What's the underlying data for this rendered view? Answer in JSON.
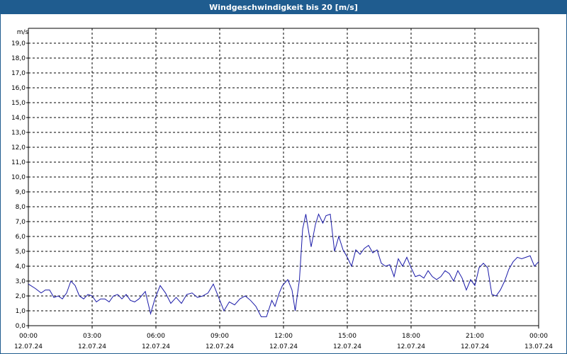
{
  "chart_data": {
    "type": "line",
    "title": "Windgeschwindigkeit bis 20 [m/s]",
    "ylabel": "m/s",
    "xlabel": "",
    "ylim": [
      0,
      20
    ],
    "xlim_hours": [
      0,
      24
    ],
    "grid": true,
    "y_ticks": [
      "0,0",
      "1,0",
      "2,0",
      "3,0",
      "4,0",
      "5,0",
      "6,0",
      "7,0",
      "8,0",
      "9,0",
      "10,0",
      "11,0",
      "12,0",
      "13,0",
      "14,0",
      "15,0",
      "16,0",
      "17,0",
      "18,0",
      "19,0"
    ],
    "x_ticks": [
      {
        "time": "00:00",
        "date": "12.07.24"
      },
      {
        "time": "03:00",
        "date": "12.07.24"
      },
      {
        "time": "06:00",
        "date": "12.07.24"
      },
      {
        "time": "09:00",
        "date": "12.07.24"
      },
      {
        "time": "12:00",
        "date": "12.07.24"
      },
      {
        "time": "15:00",
        "date": "12.07.24"
      },
      {
        "time": "18:00",
        "date": "12.07.24"
      },
      {
        "time": "21:00",
        "date": "12.07.24"
      },
      {
        "time": "00:00",
        "date": "13.07.24"
      }
    ],
    "series_color": "#1a1aa8",
    "series": [
      {
        "hours": [
          0,
          0.33,
          0.6,
          0.8,
          1.0,
          1.2,
          1.4,
          1.6,
          1.8,
          2.0,
          2.2,
          2.4,
          2.6,
          2.8,
          3.0,
          3.2,
          3.4,
          3.6,
          3.8,
          4.0,
          4.2,
          4.4,
          4.6,
          4.8,
          5.0,
          5.2,
          5.5,
          5.75,
          5.95,
          6.2,
          6.45,
          6.7,
          6.95,
          7.2,
          7.45,
          7.7,
          7.95,
          8.2,
          8.45,
          8.7,
          8.95,
          9.2,
          9.45,
          9.7,
          9.95,
          10.2,
          10.45,
          10.7,
          10.95,
          11.2,
          11.45,
          11.6,
          11.8,
          11.95,
          12.2,
          12.4,
          12.55,
          12.75,
          12.9,
          13.05,
          13.3,
          13.5,
          13.65,
          13.85,
          14.0,
          14.2,
          14.4,
          14.6,
          14.8,
          15.0,
          15.2,
          15.4,
          15.6,
          15.8,
          16.0,
          16.2,
          16.4,
          16.6,
          16.8,
          17.0,
          17.2,
          17.4,
          17.6,
          17.8,
          18.0,
          18.2,
          18.4,
          18.6,
          18.8,
          19.0,
          19.2,
          19.4,
          19.6,
          19.8,
          20.0,
          20.2,
          20.4,
          20.6,
          20.8,
          21.0,
          21.2,
          21.4,
          21.6,
          21.8,
          22.0,
          22.2,
          22.4,
          22.6,
          22.8,
          23.0,
          23.2,
          23.4,
          23.6,
          23.8,
          24.0
        ],
        "values": [
          2.8,
          2.5,
          2.2,
          2.4,
          2.4,
          1.9,
          2.0,
          1.8,
          2.2,
          3.0,
          2.7,
          2.0,
          1.8,
          2.1,
          2.0,
          1.6,
          1.8,
          1.8,
          1.6,
          2.0,
          2.1,
          1.8,
          2.1,
          1.7,
          1.6,
          1.8,
          2.3,
          0.8,
          1.8,
          2.7,
          2.2,
          1.5,
          1.9,
          1.5,
          2.1,
          2.2,
          1.9,
          2.0,
          2.2,
          2.8,
          1.9,
          1.0,
          1.6,
          1.4,
          1.8,
          2.0,
          1.7,
          1.3,
          0.6,
          0.6,
          1.7,
          1.3,
          2.2,
          2.7,
          3.1,
          2.4,
          1.0,
          3.1,
          6.5,
          7.5,
          5.3,
          6.8,
          7.5,
          6.9,
          7.4,
          7.5,
          5.0,
          6.0,
          5.1,
          4.6,
          4.0,
          5.1,
          4.8,
          5.2,
          5.4,
          4.9,
          5.1,
          4.2,
          4.0,
          4.1,
          3.3,
          4.5,
          4.0,
          4.6,
          3.9,
          3.3,
          3.4,
          3.2,
          3.7,
          3.3,
          3.1,
          3.3,
          3.7,
          3.5,
          3.0,
          3.7,
          3.2,
          2.4,
          3.1,
          2.7,
          3.9,
          4.2,
          3.9,
          2.1,
          2.0,
          2.4,
          3.0,
          3.8,
          4.3,
          4.6,
          4.5,
          4.6,
          4.7,
          4.0,
          4.3,
          4.1,
          4.1,
          3.9,
          4.0,
          4.4,
          3.0,
          2.2,
          3.2,
          3.8,
          4.0,
          4.7,
          5.0,
          4.7,
          5.1,
          4.9
        ]
      }
    ]
  }
}
